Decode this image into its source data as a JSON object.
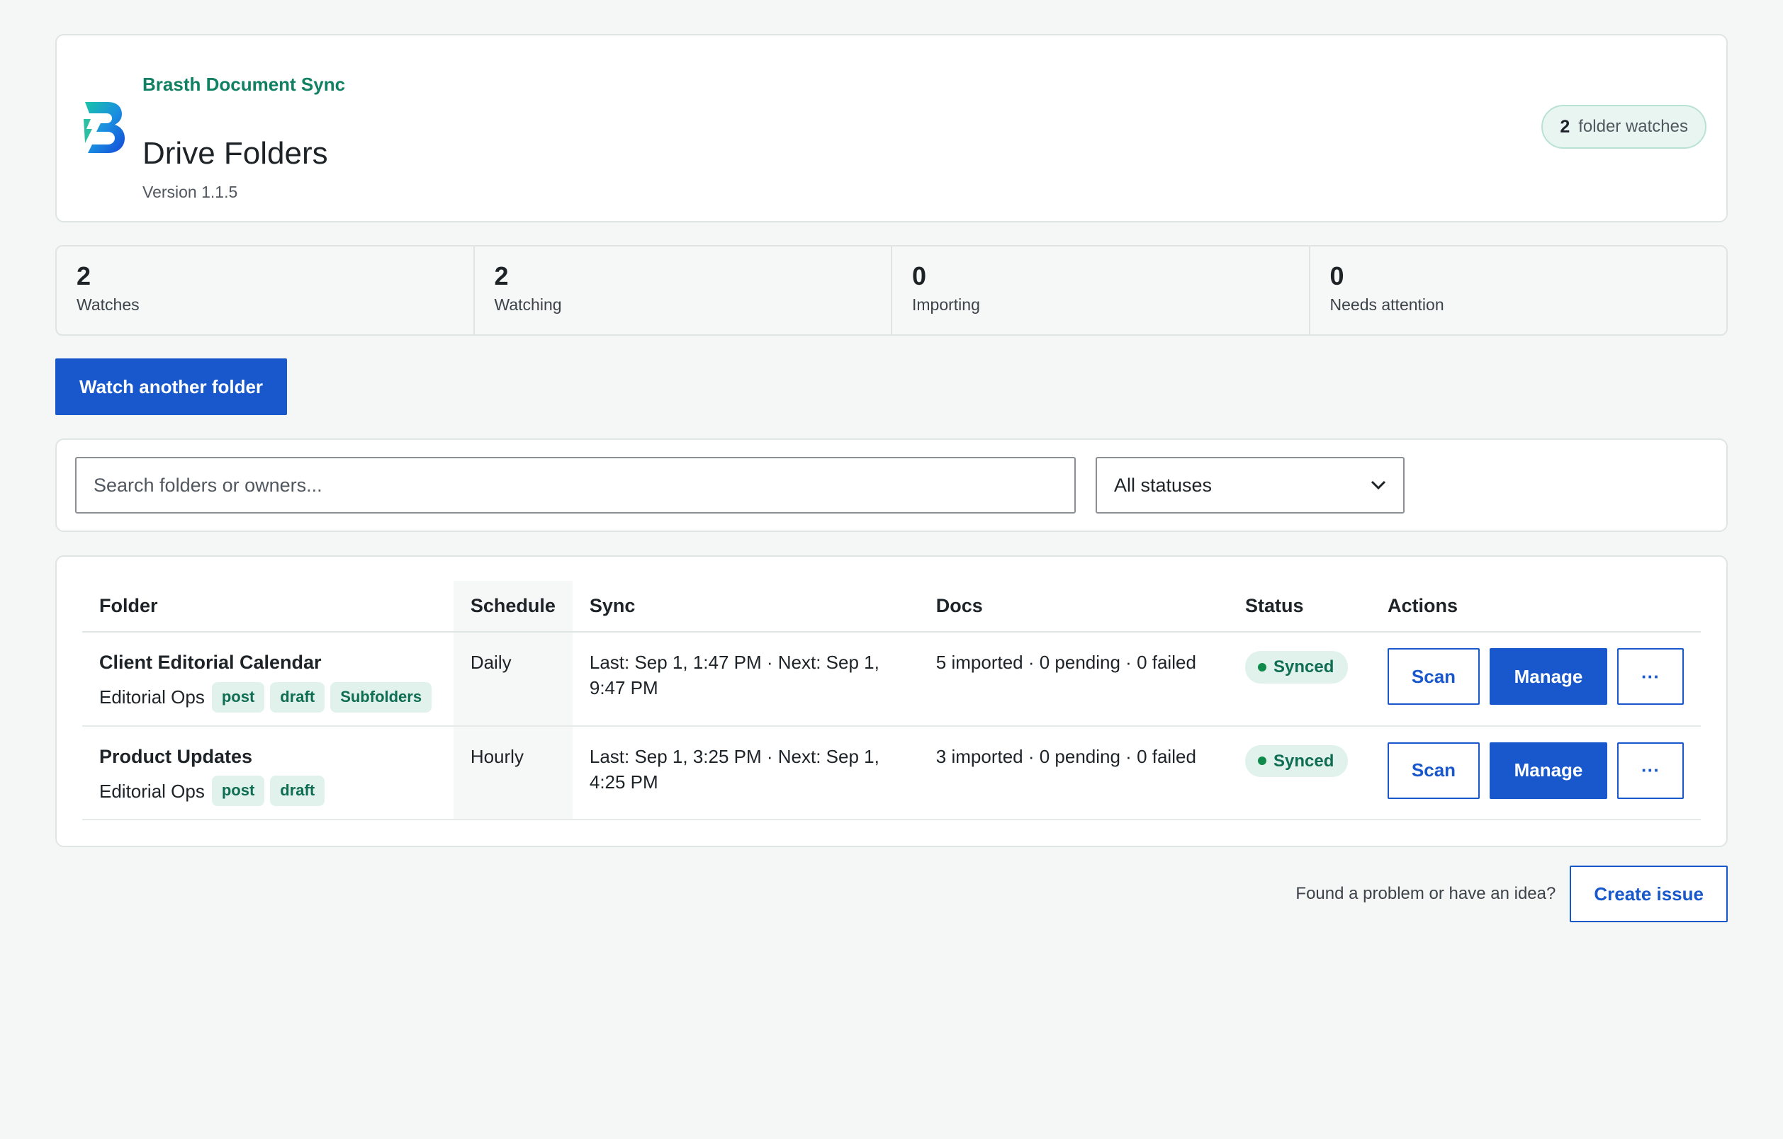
{
  "header": {
    "brand": "Brasth Document Sync",
    "title": "Drive Folders",
    "version": "Version 1.1.5",
    "watch_count": "2",
    "watch_label": "folder watches",
    "logo_icon": "brasth-b-logo"
  },
  "stats": [
    {
      "value": "2",
      "label": "Watches"
    },
    {
      "value": "2",
      "label": "Watching"
    },
    {
      "value": "0",
      "label": "Importing"
    },
    {
      "value": "0",
      "label": "Needs attention"
    }
  ],
  "primary_action": "Watch another folder",
  "filters": {
    "search_placeholder": "Search folders or owners...",
    "status_selected": "All statuses",
    "status_icon": "chevron-down-icon"
  },
  "table": {
    "columns": [
      "Folder",
      "Schedule",
      "Sync",
      "Docs",
      "Status",
      "Actions"
    ],
    "rows": [
      {
        "folder": "Client Editorial Calendar",
        "owner": "Editorial Ops",
        "tags": [
          "post",
          "draft",
          "Subfolders"
        ],
        "schedule": "Daily",
        "sync": "Last: Sep 1, 1:47 PM · Next: Sep 1, 9:47 PM",
        "docs": "5 imported · 0 pending · 0 failed",
        "status": "Synced",
        "scan": "Scan",
        "manage": "Manage",
        "more": "···"
      },
      {
        "folder": "Product Updates",
        "owner": "Editorial Ops",
        "tags": [
          "post",
          "draft"
        ],
        "schedule": "Hourly",
        "sync": "Last: Sep 1, 3:25 PM · Next: Sep 1, 4:25 PM",
        "docs": "3 imported · 0 pending · 0 failed",
        "status": "Synced",
        "scan": "Scan",
        "manage": "Manage",
        "more": "···"
      }
    ]
  },
  "footer": {
    "text": "Found a problem or have an idea?",
    "button": "Create issue"
  },
  "colors": {
    "accent": "#1858cc",
    "brand": "#0f8062",
    "status_ok": "#0f8a4a"
  }
}
